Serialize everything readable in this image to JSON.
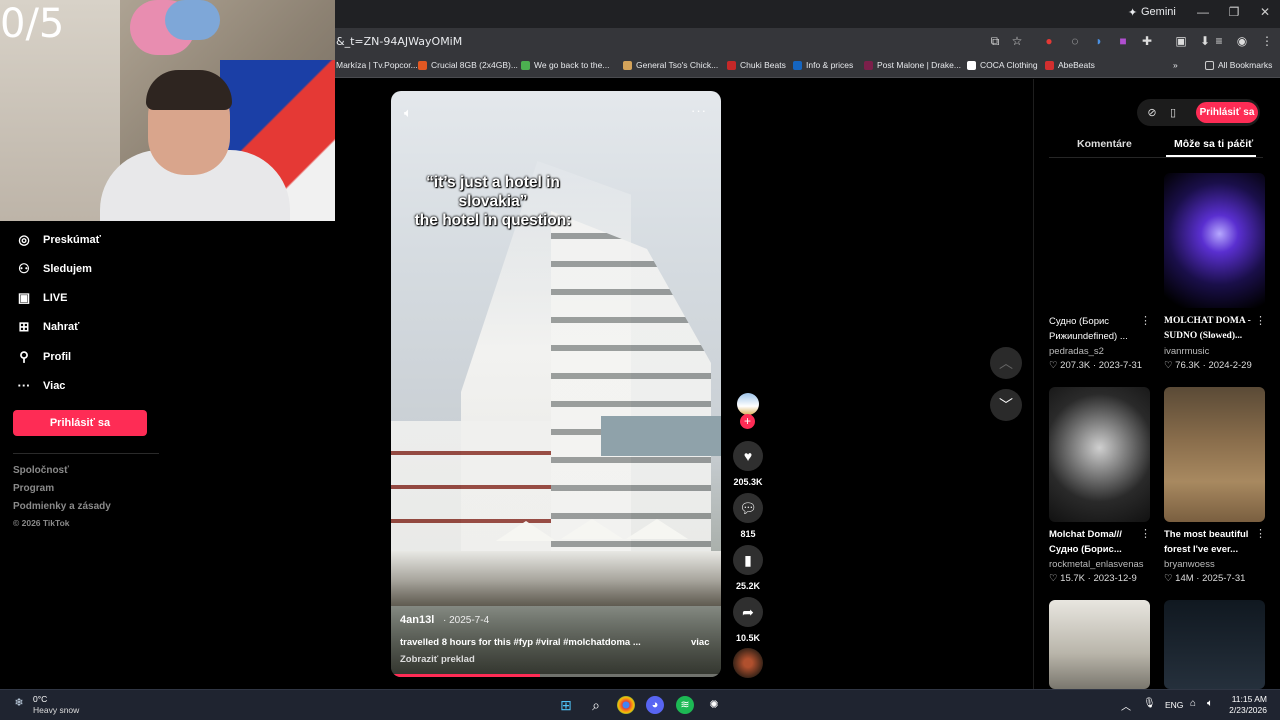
{
  "browser": {
    "profile_label": "Gemini",
    "url": "&_t=ZN-94AJWayOMiM",
    "bookmarks": [
      {
        "label": "Markíza | Tv.Popcor...",
        "color": "#f0a020"
      },
      {
        "label": "Crucial 8GB (2x4GB)...",
        "color": "#e25822"
      },
      {
        "label": "We go back to the...",
        "color": "#4caf50"
      },
      {
        "label": "General Tso's Chick...",
        "color": "#d4a35a"
      },
      {
        "label": "Chuki Beats",
        "color": "#c62828"
      },
      {
        "label": "Info & prices",
        "color": "#1565c0"
      },
      {
        "label": "Post Malone | Drake...",
        "color": "#7b1f4a"
      },
      {
        "label": "COCA Clothing",
        "color": "#222222"
      },
      {
        "label": "AbeBeats",
        "color": "#d32f2f"
      }
    ],
    "all_bookmarks": "All Bookmarks"
  },
  "stream": {
    "counter": "0/5"
  },
  "sidebar": {
    "items": [
      {
        "label": "Preskúmať",
        "icon": "compass-icon"
      },
      {
        "label": "Sledujem",
        "icon": "following-icon"
      },
      {
        "label": "LIVE",
        "icon": "live-icon"
      },
      {
        "label": "Nahrať",
        "icon": "upload-icon"
      },
      {
        "label": "Profil",
        "icon": "profile-icon"
      },
      {
        "label": "Viac",
        "icon": "more-icon"
      }
    ],
    "login_label": "Prihlásiť sa",
    "footer": [
      "Spoločnosť",
      "Program",
      "Podmienky a zásady",
      "© 2026 TikTok"
    ]
  },
  "video": {
    "caption_line1": "“it’s just a hotel in",
    "caption_line2": "slovakia”",
    "caption_line3": "the hotel in question:",
    "author": "4an13l",
    "date": "· 2025-7-4",
    "description": "travelled 8 hours for this #fyp #viral #molchatdoma ...",
    "more_label": "viac",
    "translate_label": "Zobraziť preklad",
    "progress": 0.45
  },
  "actions": {
    "likes": "205.3K",
    "comments": "815",
    "saves": "25.2K",
    "shares": "10.5K"
  },
  "right_panel": {
    "login_label": "Prihlásiť sa",
    "tabs": [
      "Komentáre",
      "Môže sa ti páčiť"
    ],
    "cards": [
      {
        "title": "Судно (Борис Рижиundefined) ...",
        "user": "pedradas_s2",
        "likes": "207.3K",
        "date": "2023-7-31"
      },
      {
        "title": "MOLCHAT DOMA - SUDNO (Slowed)...",
        "user": "ivanrmusic",
        "likes": "76.3K",
        "date": "2024-2-29"
      },
      {
        "title": "Molchat Doma/// Судно (Борис...",
        "user": "rockmetal_enlasvenas",
        "likes": "15.7K",
        "date": "2023-12-9"
      },
      {
        "title": "The most beautiful forest I've ever...",
        "user": "bryanwoess",
        "likes": "14M",
        "date": "2025-7-31"
      }
    ]
  },
  "taskbar": {
    "temp": "0°C",
    "weather": "Heavy snow",
    "lang": "ENG",
    "time": "11:15 AM",
    "date": "2/23/2026"
  }
}
